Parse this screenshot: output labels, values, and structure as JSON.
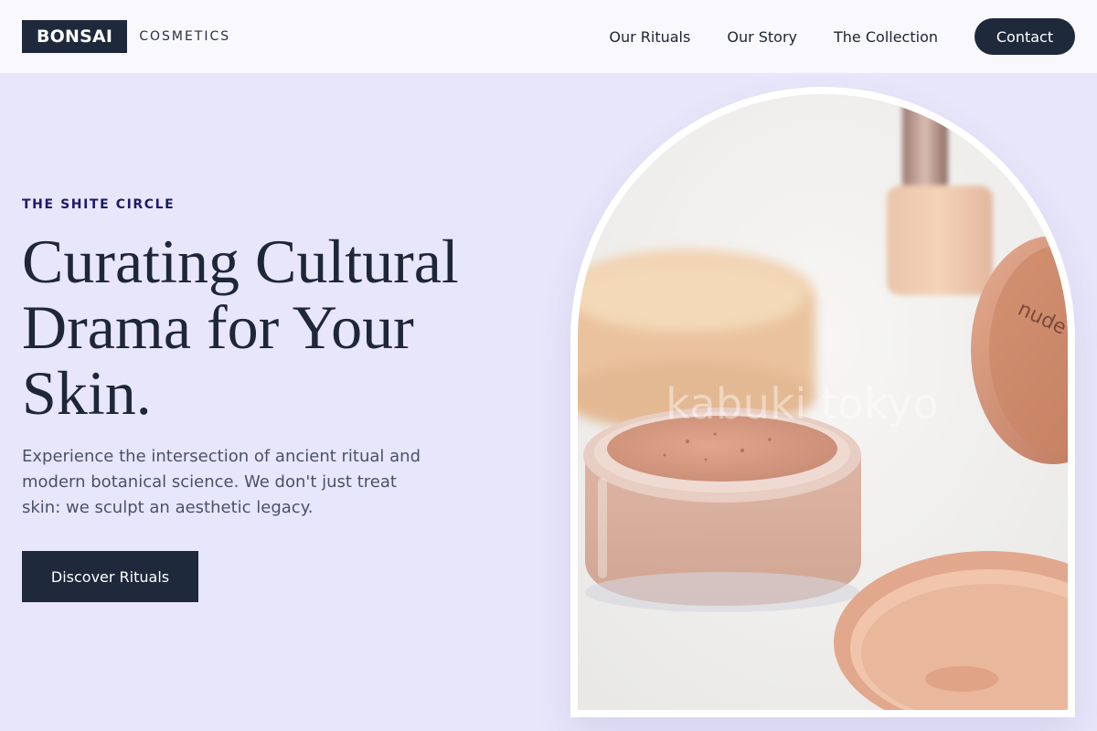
{
  "brand": {
    "name": "BONSAI",
    "subtitle": "COSMETICS"
  },
  "nav": {
    "links": [
      "Our Rituals",
      "Our Story",
      "The Collection"
    ],
    "contact_label": "Contact"
  },
  "hero": {
    "eyebrow": "THE SHITE CIRCLE",
    "headline_lines": [
      "Curating Cultural",
      "Drama for Your",
      "Skin."
    ],
    "lede": "Experience the intersection of ancient ritual and modern botanical science. We don't just treat skin: we sculpt an aesthetic legacy.",
    "cta_label": "Discover Rituals"
  },
  "image": {
    "jar_lid_text": "nude",
    "watermark": "kabuki tokyo"
  },
  "colors": {
    "page_bg": "#e8e6fa",
    "header_bg": "#f8f8fd",
    "primary": "#1e293b",
    "eyebrow": "#1b1a6a"
  }
}
